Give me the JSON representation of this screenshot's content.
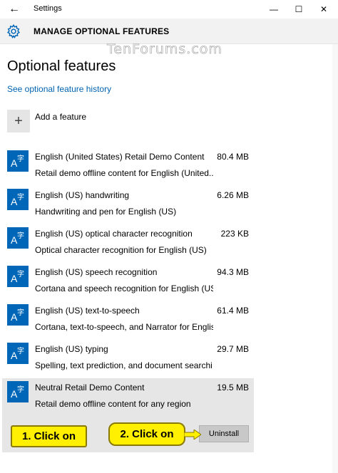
{
  "window": {
    "title": "Settings",
    "back_glyph": "←",
    "minimize_glyph": "—",
    "maximize_glyph": "☐",
    "close_glyph": "✕"
  },
  "header": {
    "title": "MANAGE OPTIONAL FEATURES",
    "icon": "gear-icon"
  },
  "watermark": "TenForums.com",
  "main": {
    "title": "Optional features",
    "history_link": "See optional feature history",
    "add_feature_label": "Add a feature",
    "features": [
      {
        "name": "English (United States) Retail Demo Content",
        "size": "80.4 MB",
        "desc": "Retail demo offline content for English (United..."
      },
      {
        "name": "English (US) handwriting",
        "size": "6.26 MB",
        "desc": "Handwriting and pen for English (US)"
      },
      {
        "name": "English (US) optical character recognition",
        "size": "223 KB",
        "desc": "Optical character recognition for English (US)"
      },
      {
        "name": "English (US) speech recognition",
        "size": "94.3 MB",
        "desc": "Cortana and speech recognition for English (US)"
      },
      {
        "name": "English (US) text-to-speech",
        "size": "61.4 MB",
        "desc": "Cortana, text-to-speech, and Narrator for Englis..."
      },
      {
        "name": "English (US) typing",
        "size": "29.7 MB",
        "desc": "Spelling, text prediction, and document searchi..."
      },
      {
        "name": "Neutral Retail Demo Content",
        "size": "19.5 MB",
        "desc": "Retail demo offline content for any region"
      }
    ],
    "uninstall_label": "Uninstall"
  },
  "annotations": {
    "callout1": "1. Click on",
    "callout2": "2. Click on",
    "color": "#ffef00"
  },
  "colors": {
    "accent": "#0067b8",
    "link": "#0063b1"
  }
}
